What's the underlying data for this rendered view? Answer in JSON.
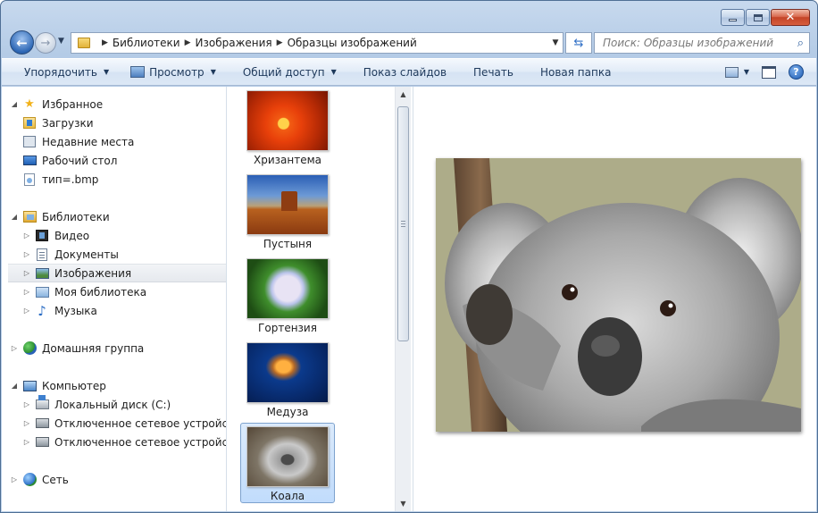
{
  "window": {
    "controls": {
      "minimize_icon": "minimize-icon",
      "maximize_icon": "maximize-icon",
      "close_glyph": "✕"
    }
  },
  "nav": {
    "breadcrumbs": [
      "Библиотеки",
      "Изображения",
      "Образцы изображений"
    ],
    "search_placeholder": "Поиск: Образцы изображений"
  },
  "toolbar": {
    "organize": "Упорядочить",
    "view": "Просмотр",
    "share": "Общий доступ",
    "slideshow": "Показ слайдов",
    "print": "Печать",
    "new_folder": "Новая папка"
  },
  "sidebar": {
    "favorites": {
      "label": "Избранное",
      "items": [
        "Загрузки",
        "Недавние места",
        "Рабочий стол",
        "тип=.bmp"
      ]
    },
    "libraries": {
      "label": "Библиотеки",
      "items": [
        "Видео",
        "Документы",
        "Изображения",
        "Моя библиотека",
        "Музыка"
      ],
      "selected": "Изображения"
    },
    "homegroup": {
      "label": "Домашняя группа"
    },
    "computer": {
      "label": "Компьютер",
      "items": [
        "Локальный диск (C:)",
        "Отключенное сетевое устройство (",
        "Отключенное сетевое устройство ("
      ]
    },
    "network": {
      "label": "Сеть"
    }
  },
  "files": {
    "items": [
      "Хризантема",
      "Пустыня",
      "Гортензия",
      "Медуза",
      "Коала"
    ],
    "selected": "Коала"
  },
  "preview": {
    "subject": "koala-photo"
  }
}
